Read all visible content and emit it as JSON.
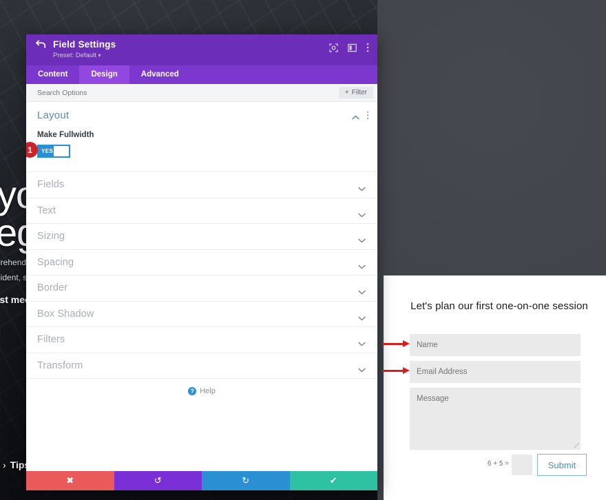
{
  "website": {
    "hero": {
      "line1": "yo",
      "line2": "eg",
      "para1": "prehender",
      "para2": "pident, sun",
      "cta": "rst mee"
    },
    "tips_label": "Tips",
    "tips_chevron": "›",
    "form": {
      "title": "Let's plan our first one-on-one session",
      "name_placeholder": "Name",
      "email_placeholder": "Email Address",
      "message_placeholder": "Message",
      "captcha_question": "6 + 5 =",
      "captcha_value": "",
      "submit_label": "Submit"
    }
  },
  "modal": {
    "title": "Field Settings",
    "preset": "Preset: Default",
    "preset_caret": "▾",
    "tabs": [
      {
        "label": "Content",
        "active": false
      },
      {
        "label": "Design",
        "active": true
      },
      {
        "label": "Advanced",
        "active": false
      }
    ],
    "search": {
      "placeholder": "Search Options",
      "value": ""
    },
    "filter_label": "Filter",
    "filter_plus": "+",
    "open_section": {
      "title": "Layout",
      "control_label": "Make Fullwidth",
      "toggle_state": "YES",
      "step_badge": "1"
    },
    "collapsed_sections": [
      {
        "label": "Fields"
      },
      {
        "label": "Text"
      },
      {
        "label": "Sizing"
      },
      {
        "label": "Spacing"
      },
      {
        "label": "Border"
      },
      {
        "label": "Box Shadow"
      },
      {
        "label": "Filters"
      },
      {
        "label": "Transform"
      }
    ],
    "help": {
      "glyph": "?",
      "label": "Help"
    },
    "footer": {
      "cancel": "✖",
      "undo": "↺",
      "redo": "↻",
      "save": "✔"
    }
  },
  "colors": {
    "header_purple": "#6c2eb9",
    "tabs_purple": "#7c37cf",
    "tab_active_purple": "#9247e0",
    "toggle_blue": "#2b8fd4",
    "section_title_blue": "#5b8ab0",
    "badge_red": "#c8252b",
    "arrow_red": "#d82020",
    "footer_cancel": "#eb5a5a",
    "footer_undo": "#7a2fd6",
    "footer_redo": "#2b8fd4",
    "footer_save": "#2ec2a3"
  }
}
